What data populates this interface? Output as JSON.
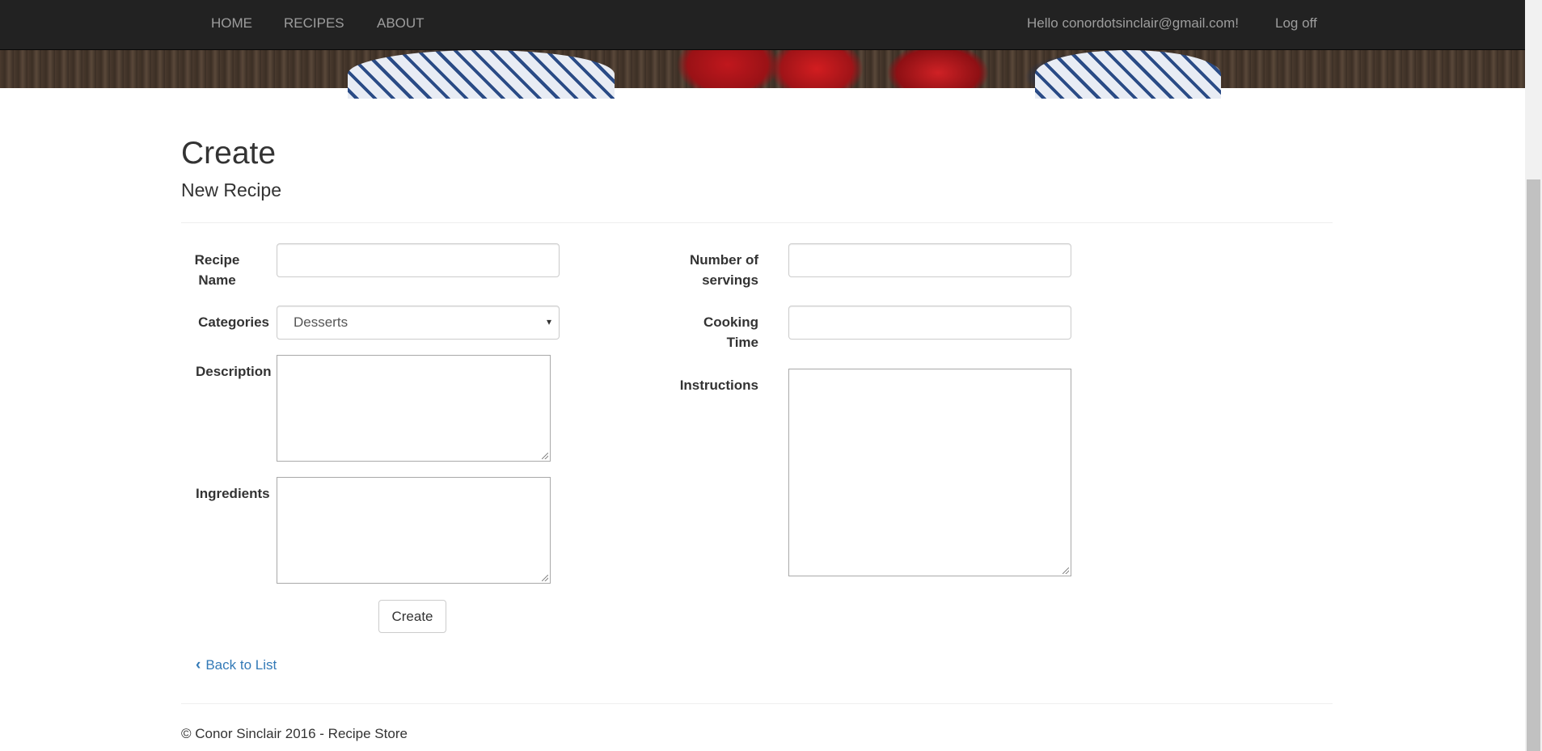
{
  "nav": {
    "home": "HOME",
    "recipes": "RECIPES",
    "about": "ABOUT",
    "greeting": "Hello conordotsinclair@gmail.com!",
    "logoff": "Log off"
  },
  "page": {
    "title": "Create",
    "subtitle": "New Recipe"
  },
  "form": {
    "recipe_name_label_1": "Recipe",
    "recipe_name_label_2": "Name",
    "recipe_name_value": "",
    "categories_label": "Categories",
    "categories_selected": "Desserts",
    "description_label": "Description",
    "ingredients_label": "Ingredients",
    "servings_label_1": "Number of",
    "servings_label_2": "servings",
    "servings_value": "",
    "cooking_time_label_1": "Cooking",
    "cooking_time_label_2": "Time",
    "cooking_time_value": "",
    "instructions_label": "Instructions",
    "create_button": "Create"
  },
  "links": {
    "back_to_list": "Back to List"
  },
  "footer": {
    "text": "© Conor Sinclair 2016 - Recipe Store"
  },
  "icons": {
    "back": "chevron-left-icon",
    "select_caret": "caret-down-icon"
  },
  "colors": {
    "navbar": "#222222",
    "link": "#337ab7"
  }
}
